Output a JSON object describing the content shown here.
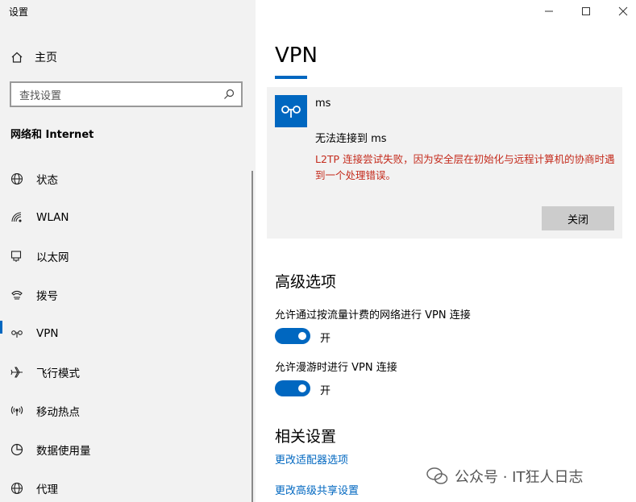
{
  "window": {
    "title": "设置",
    "minimize_icon": "minimize-icon",
    "maximize_icon": "maximize-icon",
    "close_icon": "close-icon"
  },
  "sidebar": {
    "home_label": "主页",
    "search_placeholder": "查找设置",
    "section_title": "网络和 Internet",
    "items": [
      {
        "label": "状态",
        "icon": "globe-icon"
      },
      {
        "label": "WLAN",
        "icon": "wifi-icon"
      },
      {
        "label": "以太网",
        "icon": "ethernet-icon"
      },
      {
        "label": "拨号",
        "icon": "dialup-icon"
      },
      {
        "label": "VPN",
        "icon": "vpn-icon",
        "active": true
      },
      {
        "label": "飞行模式",
        "icon": "airplane-icon"
      },
      {
        "label": "移动热点",
        "icon": "hotspot-icon"
      },
      {
        "label": "数据使用量",
        "icon": "data-usage-icon"
      },
      {
        "label": "代理",
        "icon": "globe-icon"
      }
    ]
  },
  "main": {
    "title": "VPN",
    "vpn": {
      "name": "ms",
      "status": "无法连接到 ms",
      "error": "L2TP 连接尝试失败，因为安全层在初始化与远程计算机的协商时遇到一个处理错误。",
      "close_label": "关闭"
    },
    "advanced": {
      "heading": "高级选项",
      "options": [
        {
          "label": "允许通过按流量计费的网络进行 VPN 连接",
          "state": "开",
          "on": true
        },
        {
          "label": "允许漫游时进行 VPN 连接",
          "state": "开",
          "on": true
        }
      ]
    },
    "related": {
      "heading": "相关设置",
      "links": [
        "更改适配器选项",
        "更改高级共享设置"
      ]
    }
  },
  "watermark": "公众号 · IT狂人日志",
  "colors": {
    "accent": "#0067c0",
    "error": "#c42b1c",
    "sidebar_bg": "#f2f2f2"
  }
}
